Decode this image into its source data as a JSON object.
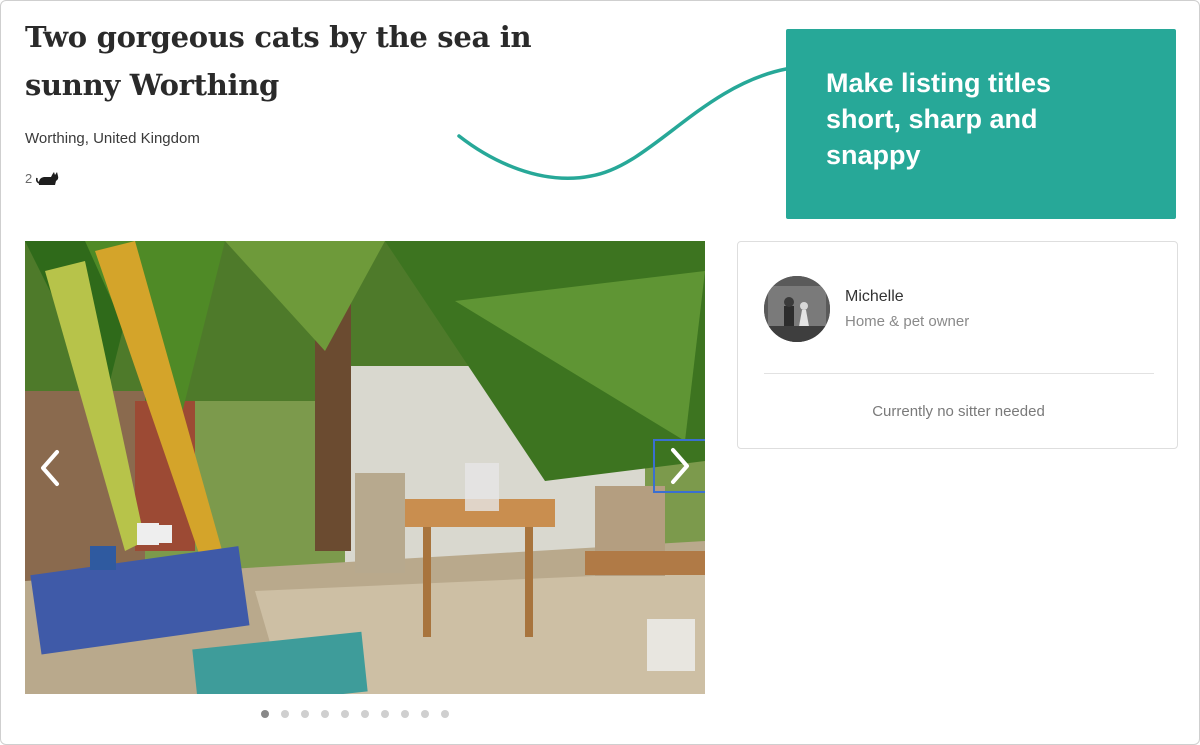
{
  "listing": {
    "title": "Two gorgeous cats by the sea in sunny Worthing",
    "location": "Worthing, United Kingdom",
    "pet_count": "2",
    "pet_icon": "cat-icon"
  },
  "callout": {
    "text": "Make listing titles short, sharp and snappy",
    "color": "#27a898"
  },
  "gallery": {
    "image_description_icon": "garden-photo",
    "prev_icon": "chevron-left-icon",
    "next_icon": "chevron-right-icon",
    "slides": 10,
    "active_slide": 1
  },
  "owner": {
    "name": "Michelle",
    "role": "Home & pet owner",
    "sitter_status": "Currently no sitter needed"
  },
  "colors": {
    "accent": "#27a898",
    "focus_outline": "#3b6fd0"
  }
}
